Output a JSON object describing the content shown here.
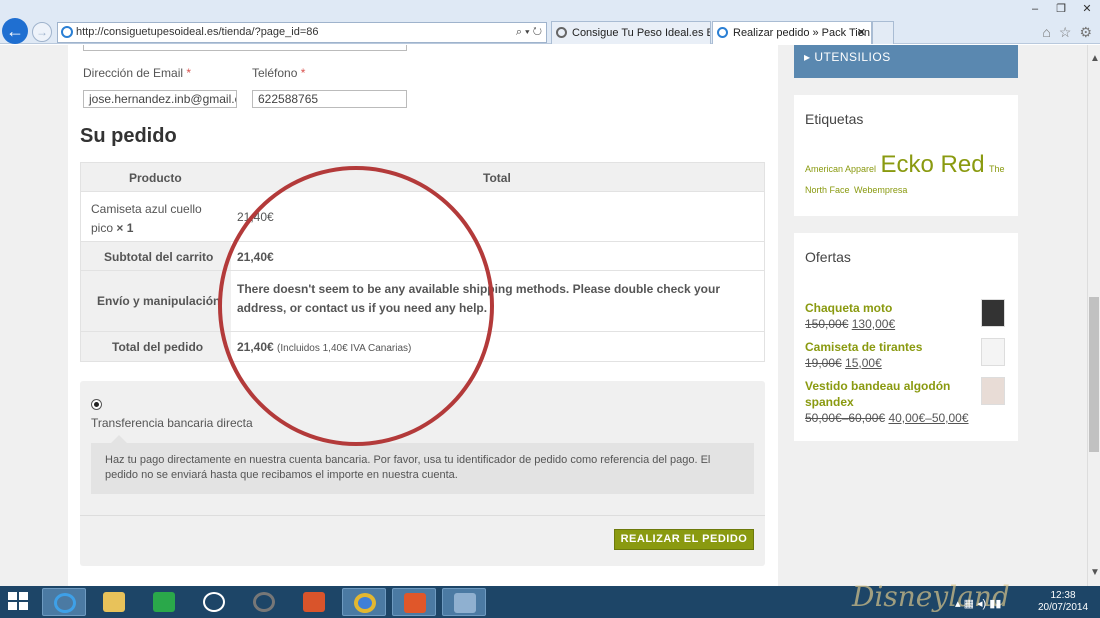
{
  "browser": {
    "url": "http://consiguetupesoideal.es/tienda/?page_id=86",
    "tabs": [
      {
        "title": "Consigue Tu Peso Ideal.es Bus..."
      },
      {
        "title": "Realizar pedido » Pack Tien..."
      }
    ]
  },
  "form": {
    "email_label": "Dirección de Email",
    "email_value": "jose.hernandez.inb@gmail.c",
    "phone_label": "Teléfono",
    "phone_value": "622588765",
    "required_mark": "*"
  },
  "order": {
    "heading": "Su pedido",
    "col_product": "Producto",
    "col_total": "Total",
    "item_name": "Camiseta azul cuello pico",
    "item_qty": "× 1",
    "item_total": "21,40€",
    "subtotal_label": "Subtotal del carrito",
    "subtotal_value": "21,40€",
    "shipping_label": "Envío y manipulación",
    "shipping_message": "There doesn't seem to be any available shipping methods. Please double check your address, or contact us if you need any help.",
    "total_label": "Total del pedido",
    "total_value": "21,40€",
    "total_tax_note": "(Incluidos 1,40€ IVA Canarias)"
  },
  "payment": {
    "method_label": "Transferencia bancaria directa",
    "description": "Haz tu pago directamente en nuestra cuenta bancaria. Por favor, usa tu identificador de pedido como referencia del pago. El pedido no se enviará hasta que recibamos el importe en nuestra cuenta.",
    "place_order": "REALIZAR EL PEDIDO"
  },
  "sidebar": {
    "utensils": "▸ UTENSILIOS",
    "tags_title": "Etiquetas",
    "tags": [
      "American Apparel",
      "Ecko Red",
      "The North Face",
      "Webempresa"
    ],
    "offers_title": "Ofertas",
    "offers": [
      {
        "name": "Chaqueta moto",
        "old": "150,00€",
        "new": "130,00€"
      },
      {
        "name": "Camiseta de tirantes",
        "old": "19,00€",
        "new": "15,00€"
      },
      {
        "name": "Vestido bandeau algodón spandex",
        "old": "50,00€–60,00€",
        "new": "40,00€–50,00€"
      }
    ]
  },
  "taskbar": {
    "watermark": "Disneyland",
    "time": "12:38",
    "date": "20/07/2014"
  },
  "colors": {
    "accent_green": "#8a9a10",
    "annotation_red": "#b33a3a",
    "menu_blue": "#5a88b0"
  }
}
